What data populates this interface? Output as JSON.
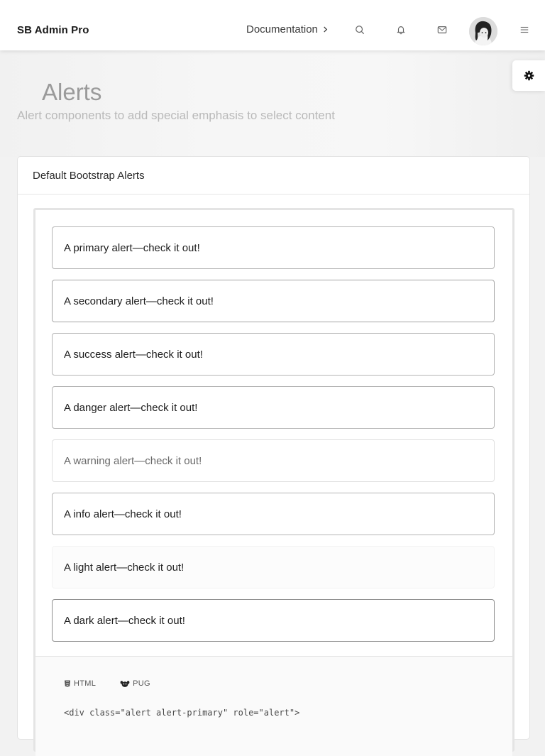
{
  "navbar": {
    "brand": "SB Admin Pro",
    "documentation_label": "Documentation",
    "icons": [
      "search-icon",
      "bell-icon",
      "mail-icon",
      "menu-icon"
    ]
  },
  "page_header": {
    "title": "Alerts",
    "subtitle": "Alert components to add special emphasis to select content"
  },
  "card": {
    "header": "Default Bootstrap Alerts",
    "alerts": [
      {
        "variant": "primary",
        "text": "A primary alert—check it out!"
      },
      {
        "variant": "secondary",
        "text": "A secondary alert—check it out!"
      },
      {
        "variant": "success",
        "text": "A success alert—check it out!"
      },
      {
        "variant": "danger",
        "text": "A danger alert—check it out!"
      },
      {
        "variant": "warning",
        "text": "A warning alert—check it out!"
      },
      {
        "variant": "info",
        "text": "A info alert—check it out!"
      },
      {
        "variant": "light",
        "text": "A light alert—check it out!"
      },
      {
        "variant": "dark",
        "text": "A dark alert—check it out!"
      }
    ],
    "code_tabs": [
      {
        "label": "HTML",
        "icon": "html5-icon"
      },
      {
        "label": "PUG",
        "icon": "pug-icon"
      }
    ],
    "code_snippet": "<div class=\"alert alert-primary\" role=\"alert\">"
  },
  "colors": {
    "page_background": "#f2f2f2",
    "card_background": "#ffffff",
    "title_text": "#9a9a9a",
    "subtitle_text": "#b9b9b9"
  }
}
